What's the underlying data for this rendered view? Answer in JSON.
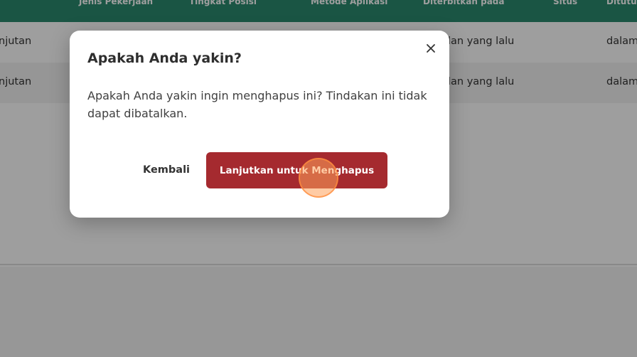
{
  "table": {
    "columns": [
      "Jenis Pekerjaan",
      "Tingkat Posisi",
      "Metode Aplikasi",
      "Diterbitkan pada",
      "Situs",
      "Ditutup"
    ],
    "rows": [
      {
        "col_a": "njutan",
        "col_b": "lan yang lalu",
        "col_c": "dalam"
      },
      {
        "col_a": "njutan",
        "col_b": "lan yang lalu",
        "col_c": "dalam"
      }
    ]
  },
  "modal": {
    "title": "Apakah Anda yakin?",
    "message": "Apakah Anda yakin ingin menghapus ini? Tindakan ini tidak dapat dibatalkan.",
    "back_label": "Kembali",
    "confirm_label": "Lanjutkan untuk Menghapus"
  },
  "colors": {
    "header": "#2a8a6e",
    "danger": "#a52a2f",
    "click_indicator": "#ffa05a"
  },
  "icons": {
    "close": "close-icon"
  }
}
